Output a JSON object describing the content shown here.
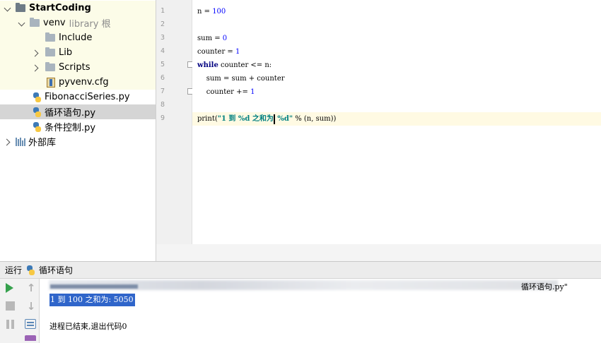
{
  "project": {
    "root": "StartCoding",
    "venv": "venv",
    "venv_tag": "library 根",
    "include": "Include",
    "lib": "Lib",
    "scripts": "Scripts",
    "cfg": "pyvenv.cfg",
    "file1": "FibonacciSeries.py",
    "file2": "循环语句.py",
    "file3": "条件控制.py",
    "external": "外部库"
  },
  "editor": {
    "line_numbers": [
      "1",
      "2",
      "3",
      "4",
      "5",
      "6",
      "7",
      "8",
      "9"
    ],
    "line1": {
      "a": "n = ",
      "b": "100"
    },
    "line3": {
      "a": "sum = ",
      "b": "0"
    },
    "line4": {
      "a": "counter = ",
      "b": "1"
    },
    "line5": {
      "kw": "while",
      "rest": " counter <= n:"
    },
    "line6": "    sum = sum + counter",
    "line7": {
      "a": "    counter += ",
      "b": "1"
    },
    "line9": {
      "a": "print(",
      "s1": "\"1 到 %d 之和为",
      "s2": " %d\"",
      "c": " % (n, sum))"
    }
  },
  "run": {
    "label": "运行",
    "config": "循环语句",
    "cmd_tail": "循环语句.py\"",
    "output": "1 到 100 之和为: 5050",
    "exit": "进程已结束,退出代码0"
  },
  "icons": {
    "run": "play-icon",
    "stop": "stop-icon",
    "pause": "pause-icon",
    "up": "up-arrow-icon",
    "down": "down-arrow-icon",
    "wrap": "soft-wrap-icon",
    "print": "print-icon"
  },
  "colors": {
    "tree_highlight": "#fcfce8",
    "selected_row": "#d5d5d5",
    "current_line": "#fffae3",
    "keyword": "#000080",
    "number": "#0000ff",
    "string": "#008080",
    "console_selection": "#2f65ca",
    "run_green": "#36a14d"
  }
}
